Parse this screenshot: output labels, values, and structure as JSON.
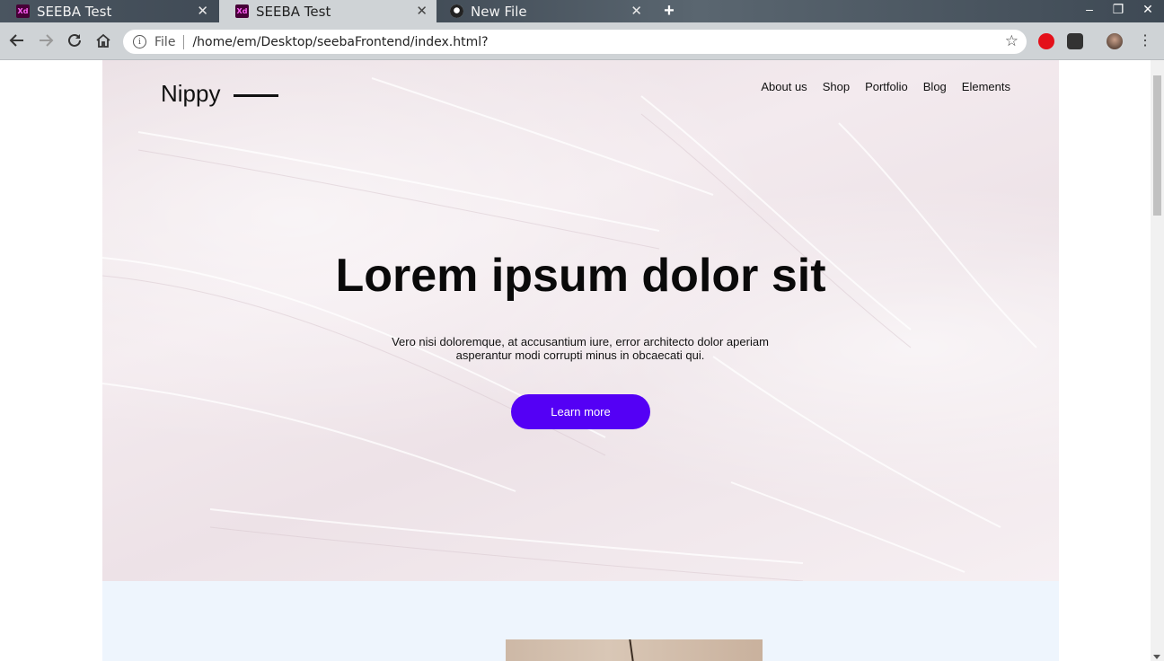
{
  "browser": {
    "tabs": [
      {
        "title": "SEEBA Test",
        "icon": "adobe-xd-icon",
        "active": false
      },
      {
        "title": "SEEBA Test",
        "icon": "adobe-xd-icon",
        "active": true
      },
      {
        "title": "New File",
        "icon": "github-icon",
        "active": false
      }
    ],
    "address": {
      "scheme": "File",
      "url": "/home/em/Desktop/seebaFrontend/index.html?"
    }
  },
  "site": {
    "brand": "Nippy",
    "nav": [
      "About us",
      "Shop",
      "Portfolio",
      "Blog",
      "Elements"
    ],
    "hero": {
      "title": "Lorem ipsum dolor sit",
      "text": "Vero nisi doloremque, at accusantium iure, error architecto dolor aperiam asperantur modi corrupti minus in obcaecati qui.",
      "cta": "Learn more"
    },
    "colors": {
      "accent": "#5400f5",
      "section_bg": "#eef5fd",
      "hero_bg": "#efe5ea"
    }
  }
}
